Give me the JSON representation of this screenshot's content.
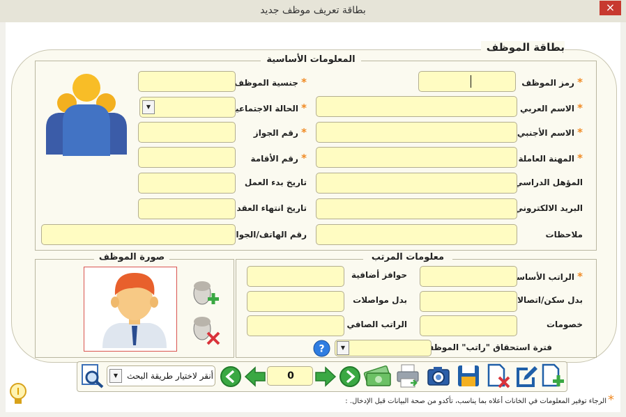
{
  "window": {
    "title": "بطاقة تعريف موظف جديد",
    "close_glyph": "×"
  },
  "card": {
    "title": "بطاقة الموظف"
  },
  "basic_info": {
    "legend": "المعلومات الأساسية",
    "required_mark": "*",
    "labels": {
      "employee_code": "رمز الموظف",
      "arabic_name": "الاسم العربي",
      "foreign_name": "الاسم الأجنبي",
      "profession": "المهنة العاملة",
      "qualification": "المؤهل الدراسي",
      "email": "البريد الالكتروني",
      "notes": "ملاحظات",
      "nationality": "جنسية الموظف",
      "marital_status": "الحالة الاجتماعية",
      "passport_no": "رقم الجواز",
      "residence_no": "رقم الأقامة",
      "start_date": "تاريخ بدء العمل",
      "contract_end": "تاريخ انتهاء العقد",
      "phone": "رقم الهاتف/الجوال"
    }
  },
  "photo": {
    "legend": "صورة الموظف"
  },
  "salary": {
    "legend": "معلومات المرتب",
    "labels": {
      "basic_salary": "الراتب الأساسي",
      "housing_allowance": "بدل سكن/اتصالات",
      "deductions": "خصومات",
      "bonuses": "حوافز أضافية",
      "transport_allowance": "بدل مواصلات",
      "net_salary": "الراتب الصافي",
      "salary_period": "فترة استحقاق \"راتب\" الموظف"
    },
    "help_glyph": "?"
  },
  "toolbar": {
    "search_method_placeholder": "أنقر لاختيار طريقة البحث",
    "record_number": "0"
  },
  "footer": {
    "asterisk": "*",
    "note": "الرجاء توفير المعلومات في الخانات أعلاه بما يناسب، تأكدو من صحة البيانات قبل الإدخال."
  },
  "colors": {
    "field": "#fffcc2",
    "required": "#f08a24",
    "close": "#c7392f",
    "nav_green": "#3aa843",
    "save_blue": "#1f5fa8"
  }
}
